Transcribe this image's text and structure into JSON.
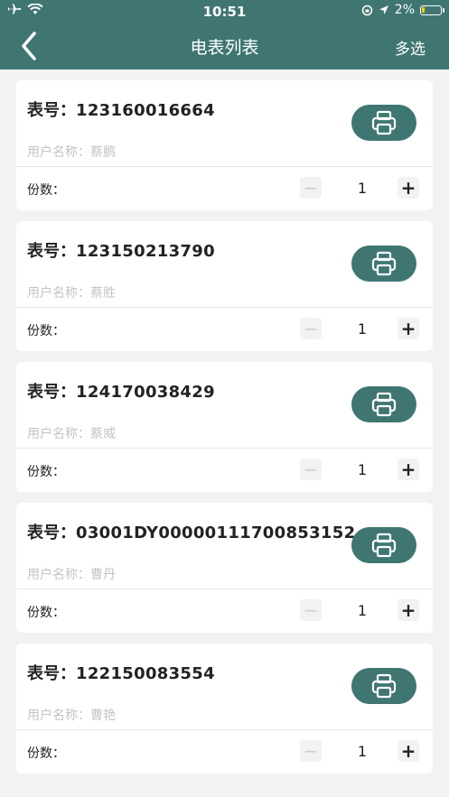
{
  "status_bar": {
    "time": "10:51",
    "battery_percent": "2%"
  },
  "nav": {
    "title": "电表列表",
    "multi_select": "多选"
  },
  "labels": {
    "meter_prefix": "表号：",
    "user_prefix": "用户名称：",
    "copies_prefix": "份数："
  },
  "items": [
    {
      "meter_no": "123160016664",
      "user_name": "蔡鹏",
      "copies": "1"
    },
    {
      "meter_no": "123150213790",
      "user_name": "蔡胜",
      "copies": "1"
    },
    {
      "meter_no": "124170038429",
      "user_name": "蔡威",
      "copies": "1"
    },
    {
      "meter_no": "03001DY00000111700853152",
      "user_name": "曹丹",
      "copies": "1"
    },
    {
      "meter_no": "122150083554",
      "user_name": "曹艳",
      "copies": "1"
    }
  ],
  "colors": {
    "header_bg": "#3f7672",
    "accent": "#3f7672",
    "page_bg": "#f2f2f2"
  }
}
